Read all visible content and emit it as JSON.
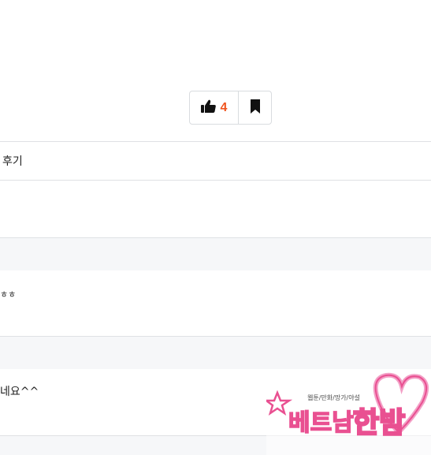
{
  "vote": {
    "like_count": "4",
    "like_icon": "thumbs-up-icon",
    "bookmark_icon": "bookmark-icon",
    "accent": "#f0541e"
  },
  "rows": [
    {
      "text": "후기"
    },
    {
      "text": "ㅎㅎ"
    },
    {
      "text": "네요^^"
    }
  ],
  "watermark": {
    "small_text": "웹툰/만화/망가/야설",
    "main_text": "베트남",
    "right_text": "한밤"
  }
}
